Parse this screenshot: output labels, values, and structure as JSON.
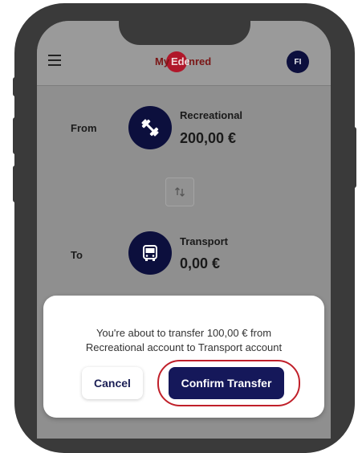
{
  "header": {
    "logo_my": "My",
    "logo_ed": "Ede",
    "logo_red": "nred",
    "avatar_initials": "FI"
  },
  "transfer": {
    "from_label": "From",
    "to_label": "To",
    "from_account": {
      "name": "Recreational",
      "amount": "200,00 €",
      "icon": "dumbbell-icon"
    },
    "to_account": {
      "name": "Transport",
      "amount": "0,00 €",
      "icon": "bus-icon"
    },
    "swap_icon": "swap-arrows-icon"
  },
  "dialog": {
    "message_line1": "You're about to transfer 100,00 € from",
    "message_line2": "Recreational account to Transport account",
    "cancel_label": "Cancel",
    "confirm_label": "Confirm Transfer"
  },
  "colors": {
    "brand_navy": "#15185a",
    "brand_red": "#b0172a",
    "highlight_outline": "#c0202a"
  }
}
